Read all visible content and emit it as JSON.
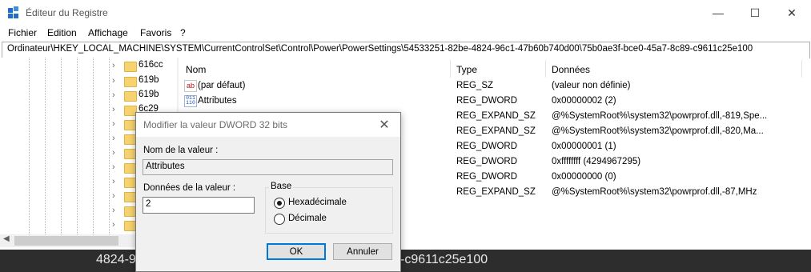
{
  "window": {
    "title": "Éditeur du Registre",
    "controls": {
      "minimize": "—",
      "maximize": "☐",
      "close": "✕"
    }
  },
  "menu": [
    "Fichier",
    "Edition",
    "Affichage",
    "Favoris",
    "?"
  ],
  "address": "Ordinateur\\HKEY_LOCAL_MACHINE\\SYSTEM\\CurrentControlSet\\Control\\Power\\PowerSettings\\54533251-82be-4824-96c1-47b60b740d00\\75b0ae3f-bce0-45a7-8c89-c9611c25e100",
  "tree": {
    "labels": [
      "616cc",
      "619b",
      "619b",
      "6c29"
    ]
  },
  "list": {
    "columns": [
      "Nom",
      "Type",
      "Données"
    ],
    "rows": [
      {
        "name": "(par défaut)",
        "type": "REG_SZ",
        "data": "(valeur non définie)",
        "icon": "string-value-icon"
      },
      {
        "name": "Attributes",
        "type": "REG_DWORD",
        "data": "0x00000002 (2)",
        "icon": "binary-value-icon"
      },
      {
        "name": "",
        "type": "REG_EXPAND_SZ",
        "data": "@%SystemRoot%\\system32\\powrprof.dll,-819,Spe...",
        "icon": ""
      },
      {
        "name": "",
        "type": "REG_EXPAND_SZ",
        "data": "@%SystemRoot%\\system32\\powrprof.dll,-820,Ma...",
        "icon": ""
      },
      {
        "name": "",
        "type": "REG_DWORD",
        "data": "0x00000001 (1)",
        "icon": ""
      },
      {
        "name": "",
        "type": "REG_DWORD",
        "data": "0xffffffff (4294967295)",
        "icon": ""
      },
      {
        "name": "",
        "type": "REG_DWORD",
        "data": "0x00000000 (0)",
        "icon": ""
      },
      {
        "name": "",
        "type": "REG_EXPAND_SZ",
        "data": "@%SystemRoot%\\system32\\powrprof.dll,-87,MHz",
        "icon": ""
      }
    ]
  },
  "background_text": {
    "left": "4824-9",
    "right": "-c9611c25e100"
  },
  "dialog": {
    "title": "Modifier la valeur DWORD 32 bits",
    "value_name_label": "Nom de la valeur :",
    "value_name": "Attributes",
    "value_data_label": "Données de la valeur :",
    "value_data": "2",
    "base_label": "Base",
    "base_options": [
      "Hexadécimale",
      "Décimale"
    ],
    "base_selected": "Hexadécimale",
    "ok_label": "OK",
    "cancel_label": "Annuler"
  },
  "colors": {
    "accent": "#0078d7",
    "folder": "#f6d36e"
  }
}
